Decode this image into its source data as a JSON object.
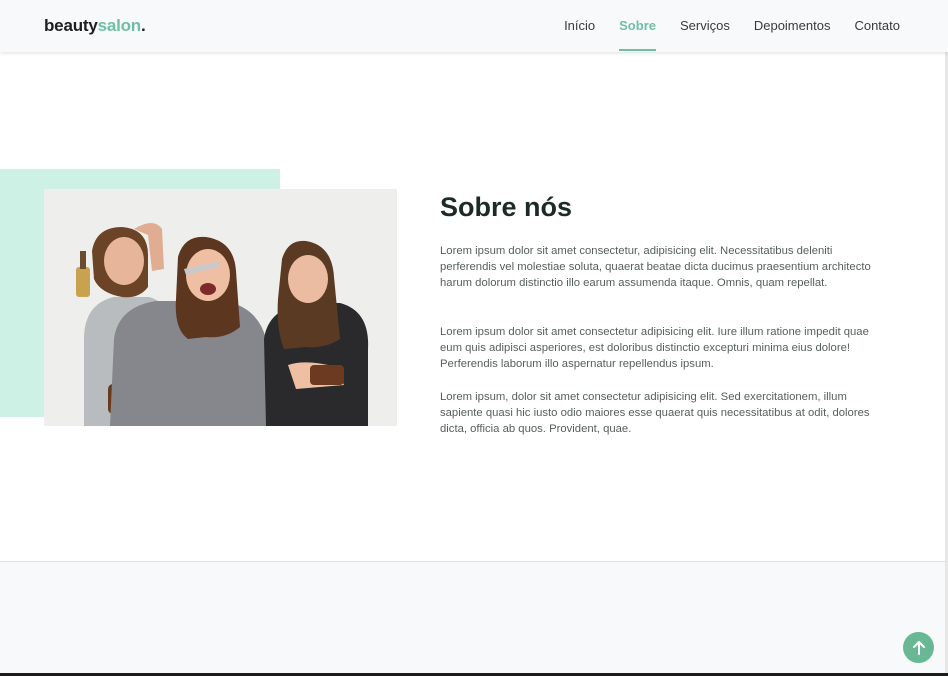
{
  "header": {
    "logo_primary": "beauty",
    "logo_accent": "salon",
    "logo_dot": ".",
    "nav": [
      {
        "label": "Início",
        "active": false
      },
      {
        "label": "Sobre",
        "active": true
      },
      {
        "label": "Serviços",
        "active": false
      },
      {
        "label": "Depoimentos",
        "active": false
      },
      {
        "label": "Contato",
        "active": false
      }
    ]
  },
  "about": {
    "title": "Sobre nós",
    "paragraphs": [
      "Lorem ipsum dolor sit amet consectetur, adipisicing elit. Necessitatibus deleniti perferendis vel molestiae soluta, quaerat beatae dicta ducimus praesentium architecto harum dolorum distinctio illo earum assumenda itaque. Omnis, quam repellat.",
      "Lorem ipsum dolor sit amet consectetur adipisicing elit. Iure illum ratione impedit quae eum quis adipisci asperiores, est doloribus distinctio excepturi minima eius dolore! Perferendis laborum illo aspernatur repellendus ipsum.",
      "Lorem ipsum, dolor sit amet consectetur adipisicing elit. Sed exercitationem, illum sapiente quasi hic iusto odio maiores esse quaerat quis necessitatibus at odit, dolores dicta, officia ab quos. Provident, quae."
    ]
  },
  "colors": {
    "accent": "#6fc0a3",
    "accent_bg": "#cdf2e5",
    "back_to_top": "#68b893",
    "heading": "#1d2b25"
  },
  "icons": {
    "back_to_top": "arrow-up-icon"
  }
}
